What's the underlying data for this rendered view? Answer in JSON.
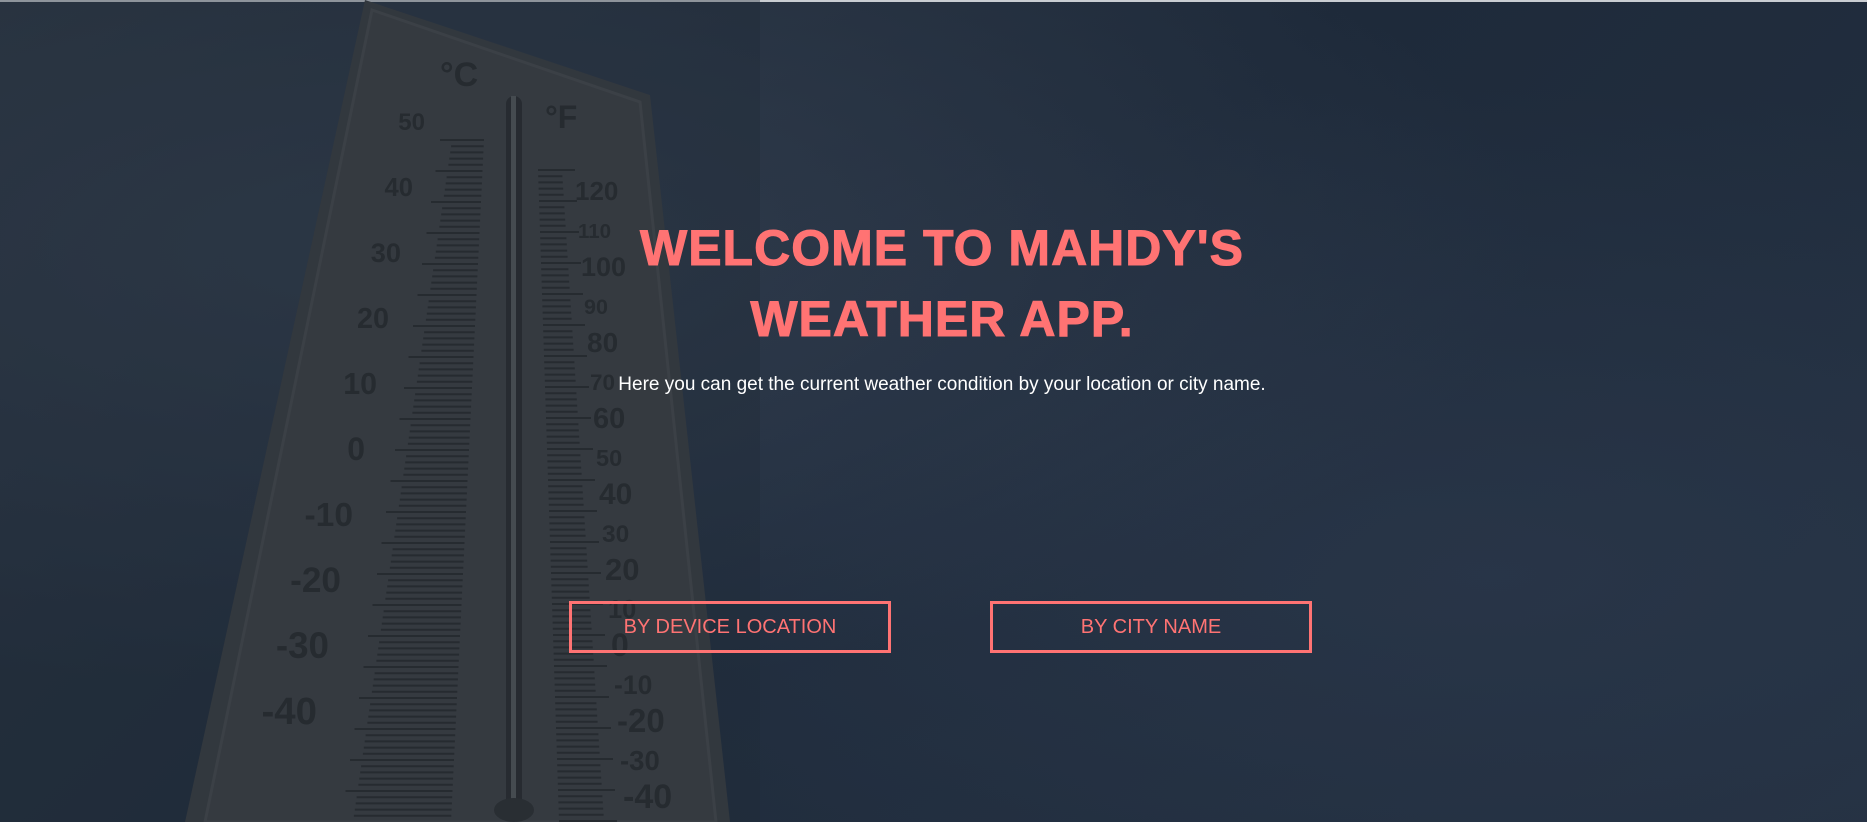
{
  "hero": {
    "title": "WELCOME TO MAHDY'S WEATHER APP.",
    "subtitle": "Here you can get the current weather condition by your location or city name."
  },
  "actions": {
    "device_location_label": "BY DEVICE LOCATION",
    "city_name_label": "BY CITY NAME"
  },
  "background": {
    "image_subject": "thermometer",
    "celsius_unit": "°C",
    "fahrenheit_unit": "°F",
    "celsius_labels": [
      "50",
      "40",
      "30",
      "20",
      "10",
      "0",
      "-10",
      "-20",
      "-30",
      "-40"
    ],
    "fahrenheit_labels": [
      "120",
      "110",
      "100",
      "90",
      "80",
      "70",
      "60",
      "50",
      "40",
      "30",
      "20",
      "10",
      "0",
      "-10",
      "-20",
      "-30",
      "-40"
    ]
  },
  "colors": {
    "accent": "#ff7373",
    "background": "#1f2a37",
    "text": "#ffffff"
  }
}
